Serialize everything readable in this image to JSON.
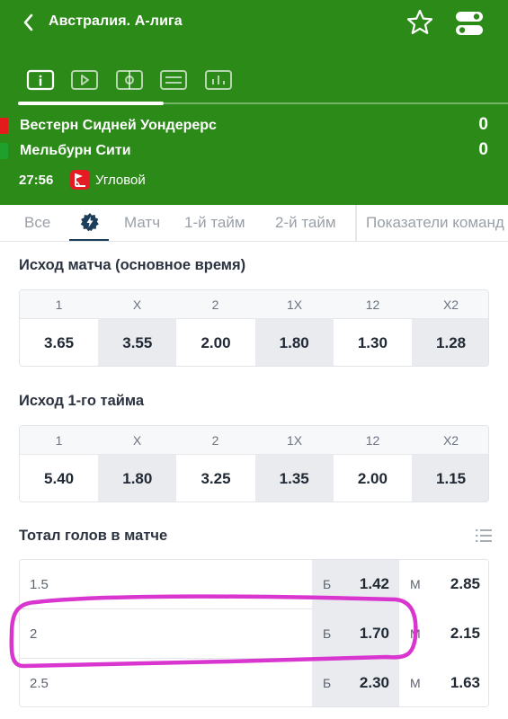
{
  "header": {
    "league_title": "Австралия. А-лига",
    "back_icon": "chevron-left-icon",
    "favorite_icon": "star-icon",
    "settings_icon": "toggle-icon",
    "mode_tabs": [
      "info-icon",
      "video-icon",
      "field-icon",
      "scoreboard-icon",
      "stats-icon"
    ],
    "teams": [
      {
        "name": "Вестерн Сидней Уондерерс",
        "score": "0",
        "marker_color": "#e21b1b"
      },
      {
        "name": "Мельбурн Сити",
        "score": "0",
        "marker_color": "#1fa02c"
      }
    ],
    "match_time": "27:56",
    "event_icon": "corner-flag-icon",
    "event_label": "Угловой",
    "background_color": "#2c8a19"
  },
  "market_tabs": {
    "items": [
      "Все",
      "Матч",
      "1-й тайм",
      "2-й тайм",
      "Показатели команд"
    ],
    "active_icon": "lightning-icon"
  },
  "sections": {
    "match_result": {
      "title": "Исход матча (основное время)",
      "headers": [
        "1",
        "X",
        "2",
        "1X",
        "12",
        "X2"
      ],
      "odds": [
        "3.65",
        "3.55",
        "2.00",
        "1.80",
        "1.30",
        "1.28"
      ]
    },
    "first_half": {
      "title": "Исход 1-го тайма",
      "headers": [
        "1",
        "X",
        "2",
        "1X",
        "12",
        "X2"
      ],
      "odds": [
        "5.40",
        "1.80",
        "3.25",
        "1.35",
        "2.00",
        "1.15"
      ]
    },
    "totals": {
      "title": "Тотал голов в матче",
      "list_icon": "list-icon",
      "over_tag": "Б",
      "under_tag": "М",
      "rows": [
        {
          "line": "1.5",
          "over": "1.42",
          "under": "2.85"
        },
        {
          "line": "2",
          "over": "1.70",
          "under": "2.15"
        },
        {
          "line": "2.5",
          "over": "2.30",
          "under": "1.63"
        }
      ]
    }
  },
  "annotation": {
    "color": "#d936cf"
  }
}
